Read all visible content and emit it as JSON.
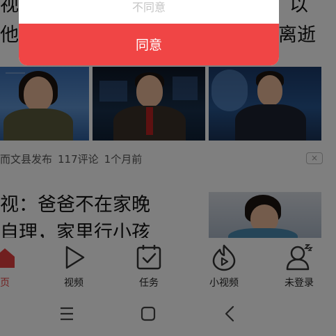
{
  "dialog": {
    "disagree_label": "不同意",
    "agree_label": "同意"
  },
  "headline_fragments": {
    "left_top": "视",
    "left_second": "他",
    "right_top": "以",
    "right_second": "离逝"
  },
  "article1": {
    "source": "而文县发布",
    "comments": "117评论",
    "time": "1个月前",
    "dismiss_label": "×"
  },
  "article2": {
    "title_line1": "视：爸爸不在家晚",
    "title_line2": "自理，家里行小孩"
  },
  "bottom_nav": [
    {
      "label": "页",
      "icon": "home-icon",
      "active": true
    },
    {
      "label": "视频",
      "icon": "play-icon",
      "active": false
    },
    {
      "label": "任务",
      "icon": "calendar-check-icon",
      "active": false
    },
    {
      "label": "小视频",
      "icon": "flame-play-icon",
      "active": false
    },
    {
      "label": "未登录",
      "icon": "user-sleep-icon",
      "active": false
    }
  ],
  "colors": {
    "accent": "#f04545",
    "active_nav": "#e33e3e",
    "scrim": "rgba(0,0,0,0.5)"
  }
}
